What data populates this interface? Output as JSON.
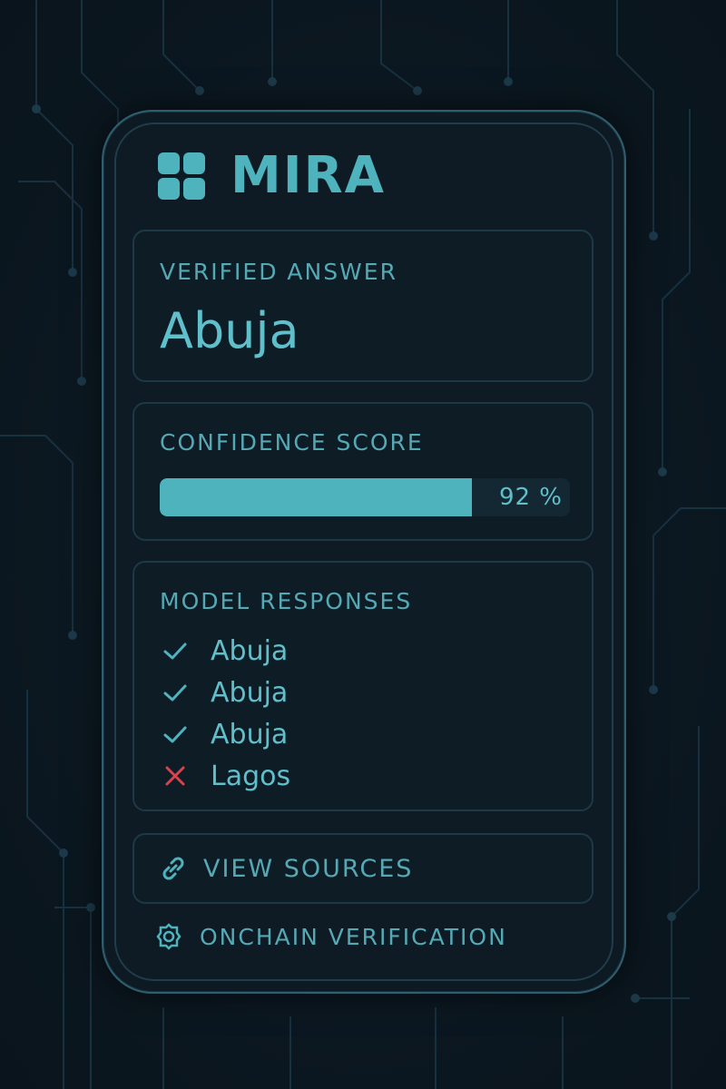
{
  "brand": {
    "name": "MIRA",
    "logo_icon": "grid-logo-icon"
  },
  "answer": {
    "label": "VERIFIED ANSWER",
    "value": "Abuja"
  },
  "confidence": {
    "label": "CONFIDENCE SCORE",
    "score_percent": 92,
    "display": "92 %"
  },
  "models": {
    "label": "MODEL RESPONSES",
    "responses": [
      {
        "text": "Abuja",
        "status": "agree",
        "icon": "check-icon"
      },
      {
        "text": "Abuja",
        "status": "agree",
        "icon": "check-icon"
      },
      {
        "text": "Abuja",
        "status": "agree",
        "icon": "check-icon"
      },
      {
        "text": "Lagos",
        "status": "disagree",
        "icon": "x-icon"
      }
    ]
  },
  "actions": {
    "view_sources": "VIEW SOURCES",
    "view_sources_icon": "link-icon",
    "onchain_verification": "ONCHAIN VERIFICATION",
    "onchain_icon": "chain-verify-icon"
  },
  "colors": {
    "accent": "#4fb3be",
    "error": "#d9434c",
    "background": "#0c1821"
  }
}
